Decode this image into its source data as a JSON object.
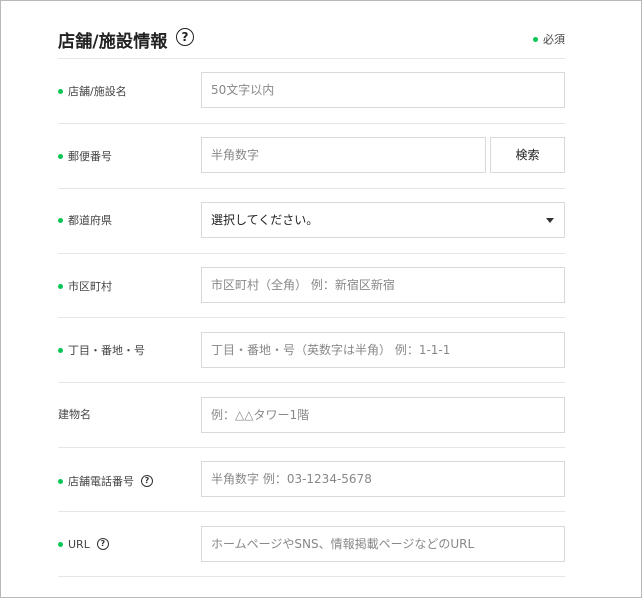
{
  "section": {
    "title": "店舗/施設情報",
    "help_symbol": "?",
    "required_label": "必須"
  },
  "fields": {
    "store_name": {
      "label": "店舗/施設名",
      "required": true,
      "placeholder": "50文字以内"
    },
    "postal_code": {
      "label": "郵便番号",
      "required": true,
      "placeholder": "半角数字",
      "button_label": "検索"
    },
    "prefecture": {
      "label": "都道府県",
      "required": true,
      "selected_value": "選択してください。"
    },
    "city": {
      "label": "市区町村",
      "required": true,
      "placeholder": "市区町村（全角） 例：新宿区新宿"
    },
    "address": {
      "label": "丁目・番地・号",
      "required": true,
      "placeholder": "丁目・番地・号（英数字は半角） 例：1-1-1"
    },
    "building": {
      "label": "建物名",
      "required": false,
      "placeholder": "例：△△タワー1階"
    },
    "phone": {
      "label": "店舗電話番号",
      "required": true,
      "help": "?",
      "placeholder": "半角数字 例：03-1234-5678"
    },
    "url": {
      "label": "URL",
      "required": true,
      "help": "?",
      "placeholder": "ホームページやSNS、情報掲載ページなどのURL"
    }
  },
  "colors": {
    "accent": "#06c755",
    "border": "#d9d9d9",
    "divider": "#e6e6e6"
  },
  "icons": {
    "help": "question-circle-icon",
    "dropdown": "caret-down-icon",
    "required_marker": "green-dot-icon"
  }
}
